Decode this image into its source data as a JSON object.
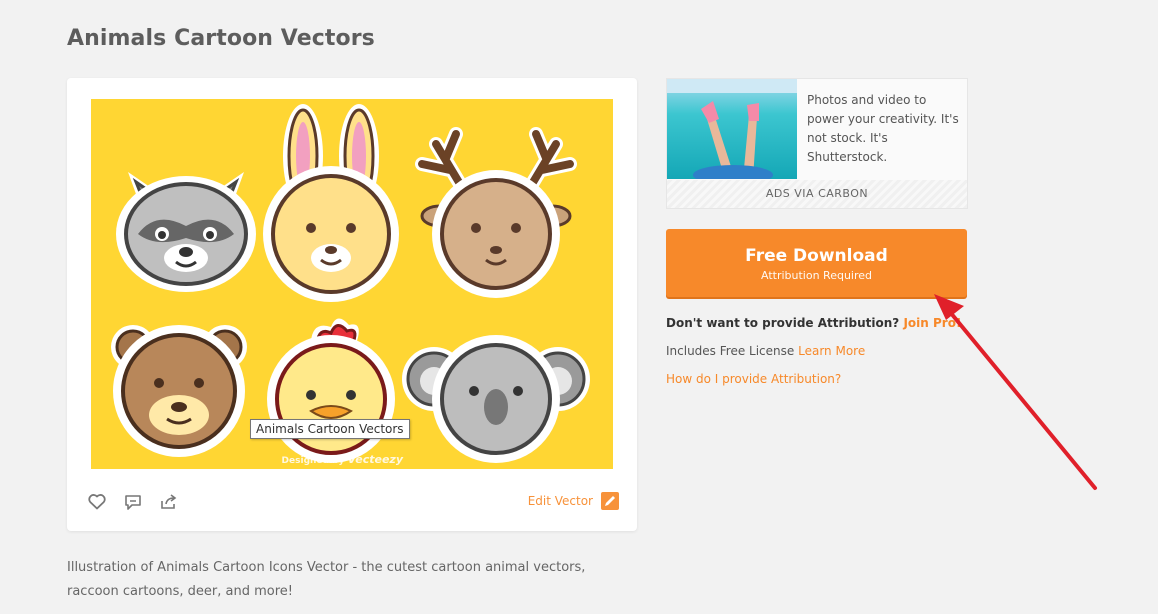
{
  "page": {
    "title": "Animals Cartoon Vectors"
  },
  "preview": {
    "tooltip": "Animals Cartoon Vectors",
    "designed_by_prefix": "Designed by",
    "designed_by_brand": "Vecteezy",
    "background_color": "#ffd633"
  },
  "card_actions": {
    "like_icon": "heart-icon",
    "comment_icon": "comment-icon",
    "share_icon": "share-icon",
    "edit_label": "Edit Vector",
    "edit_icon": "edit-vector-icon"
  },
  "description": "Illustration of Animals Cartoon Icons Vector - the cutest cartoon animal vectors, raccoon cartoons, deer, and more!",
  "ad": {
    "text": "Photos and video to power your creativity. It's not stock. It's Shutterstock.",
    "footer": "ADS VIA CARBON"
  },
  "download": {
    "label": "Free Download",
    "sublabel": "Attribution Required",
    "color": "#f7892a"
  },
  "attribution": {
    "question": "Don't want to provide Attribution?",
    "join_link": "Join Pro!",
    "license_text": "Includes Free License",
    "license_link": "Learn More",
    "howto_link": "How do I provide Attribution?"
  },
  "annotation": {
    "arrow_color": "#e0202a"
  }
}
